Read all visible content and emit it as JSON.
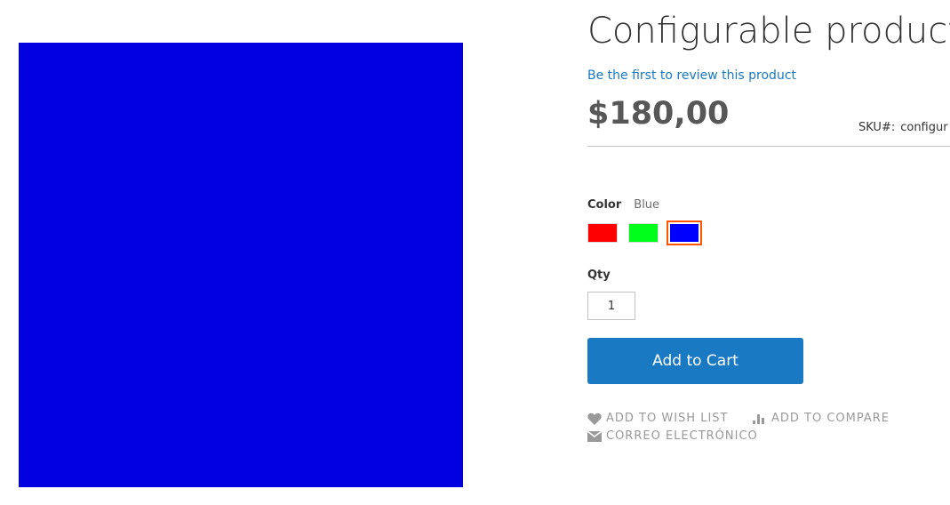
{
  "product": {
    "title": "Configurable product",
    "review_link": "Be the first to review this product",
    "price": "$180,00",
    "sku_label": "SKU#:",
    "sku_value": "configur",
    "image_color": "#0000e0"
  },
  "options": {
    "color_label": "Color",
    "color_selected": "Blue",
    "swatches": [
      {
        "name": "Red",
        "color": "#ff0000",
        "selected": false
      },
      {
        "name": "Green",
        "color": "#00ff1a",
        "selected": false
      },
      {
        "name": "Blue",
        "color": "#0000ff",
        "selected": true
      }
    ],
    "selected_outline_color": "#ff5501"
  },
  "qty": {
    "label": "Qty",
    "value": "1"
  },
  "actions": {
    "add_to_cart": "Add to Cart",
    "wishlist": "Add to Wish List",
    "compare": "Add to Compare",
    "email": "Correo Electrónico"
  }
}
